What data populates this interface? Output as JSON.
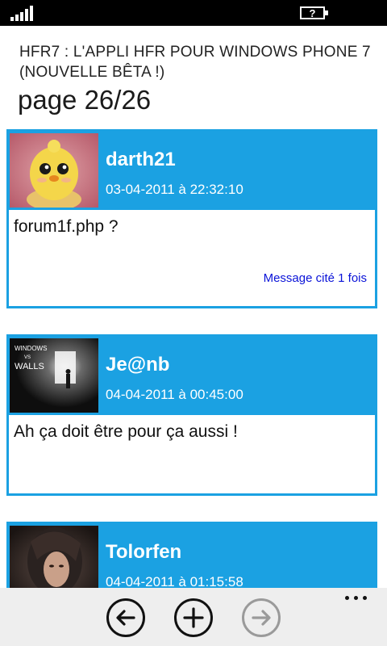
{
  "status_bar": {
    "signal_icon": "signal-bars-icon",
    "battery_icon": "battery-unknown-icon",
    "battery_text": "?"
  },
  "header": {
    "app_title": "HFR7 : L'APPLI HFR POUR WINDOWS PHONE 7 (NOUVELLE BÊTA !)",
    "page_label": "page 26/26"
  },
  "posts": [
    {
      "author": "darth21",
      "date": "03-04-2011 à 22:32:10",
      "message": "forum1f.php ?",
      "quoted_label": "Message cité 1 fois",
      "avatar": "yellow-chick-avatar"
    },
    {
      "author": "Je@nb",
      "date": "04-04-2011 à 00:45:00",
      "message": "Ah ça doit être pour ça aussi !",
      "quoted_label": "",
      "avatar": "windows-vs-walls-avatar",
      "avatar_text": [
        "WINDOWS",
        "VS",
        "WALLS"
      ]
    },
    {
      "author": "Tolorfen",
      "date": "04-04-2011 à 01:15:58",
      "message": "",
      "quoted_label": "",
      "avatar": "dark-haired-woman-avatar"
    }
  ],
  "app_bar": {
    "buttons": [
      {
        "icon": "arrow-left-icon",
        "enabled": true
      },
      {
        "icon": "plus-icon",
        "enabled": true
      },
      {
        "icon": "arrow-right-icon",
        "enabled": false
      }
    ],
    "more_icon": "ellipsis-icon"
  },
  "colors": {
    "accent": "#1ba1e2",
    "link": "#0a13d8",
    "app_bar": "#eeeeee",
    "status_bar": "#000000"
  }
}
